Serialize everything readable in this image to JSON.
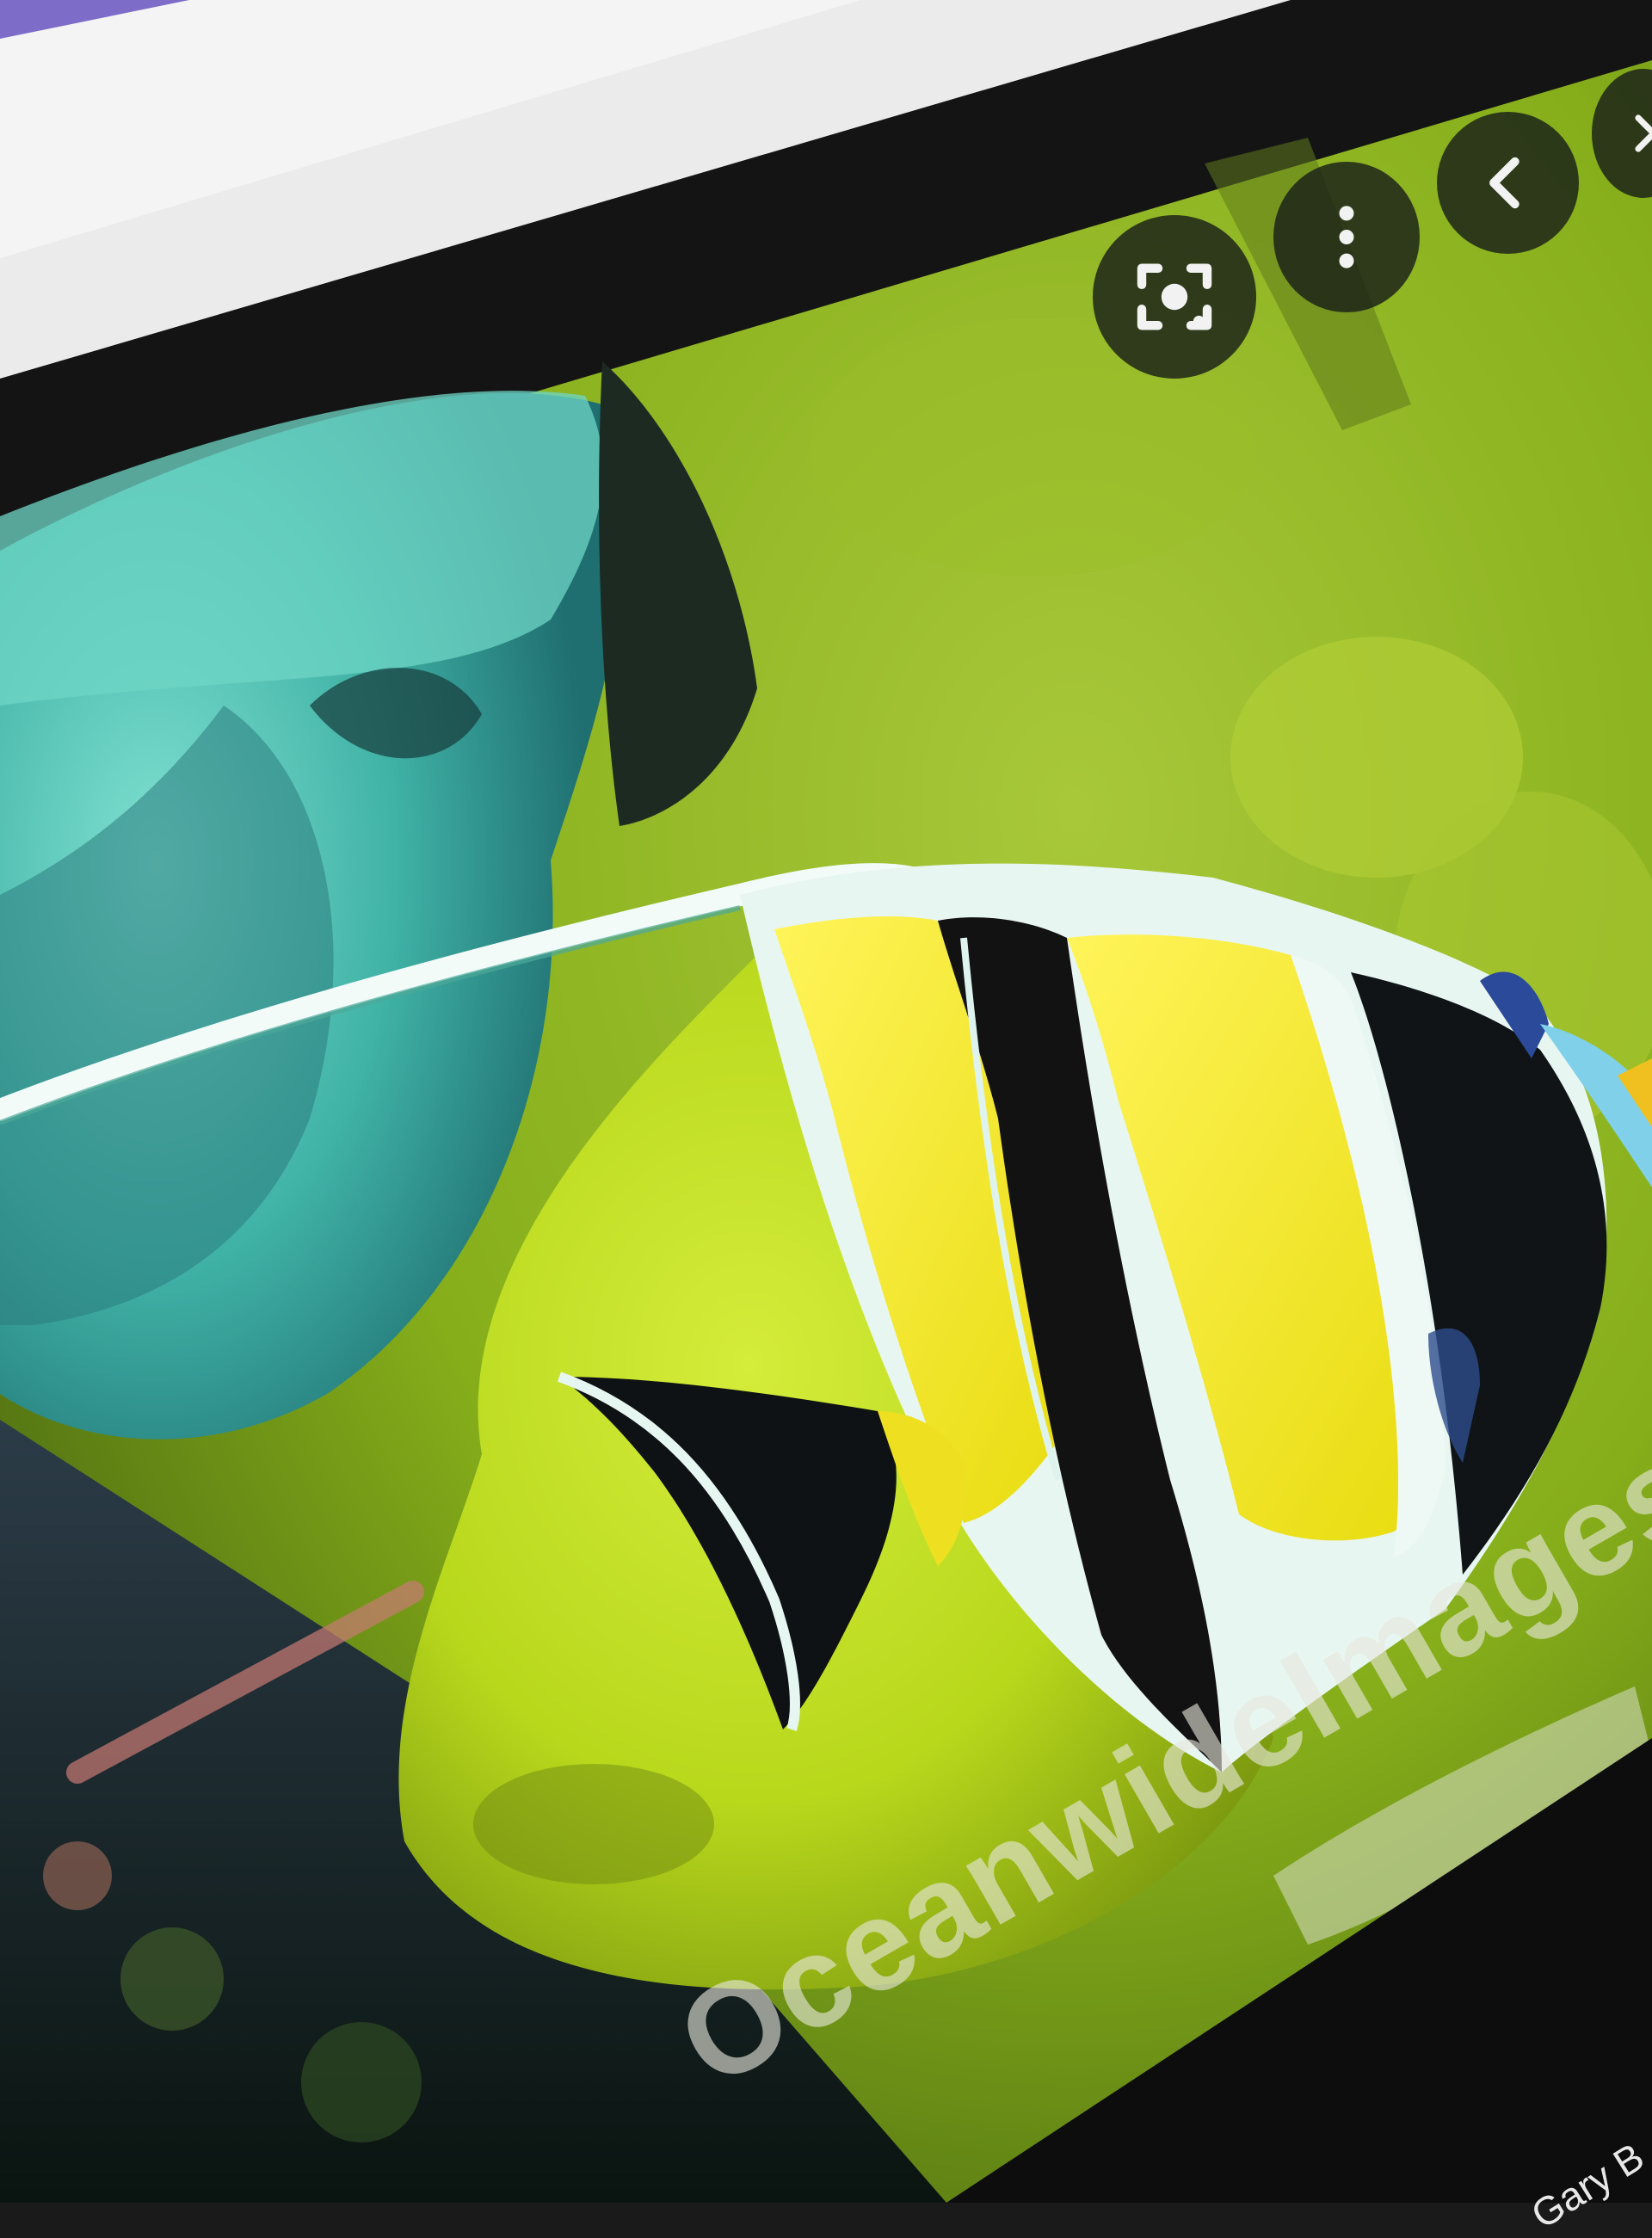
{
  "viewer": {
    "watermark": "OceanwideImages",
    "credit": "Gary B",
    "buttons": {
      "lens": "lens-icon",
      "more": "more-vertical-icon",
      "previous": "chevron-left-icon",
      "next": "chevron-right-icon"
    }
  },
  "colors": {
    "fish_yellow": "#f2e82a",
    "fish_black": "#121212",
    "fish_white": "#e8f6f2",
    "background_green": "#8fb820",
    "coral_cyan": "#4fc0b0",
    "button_bg": "#1e231e"
  }
}
